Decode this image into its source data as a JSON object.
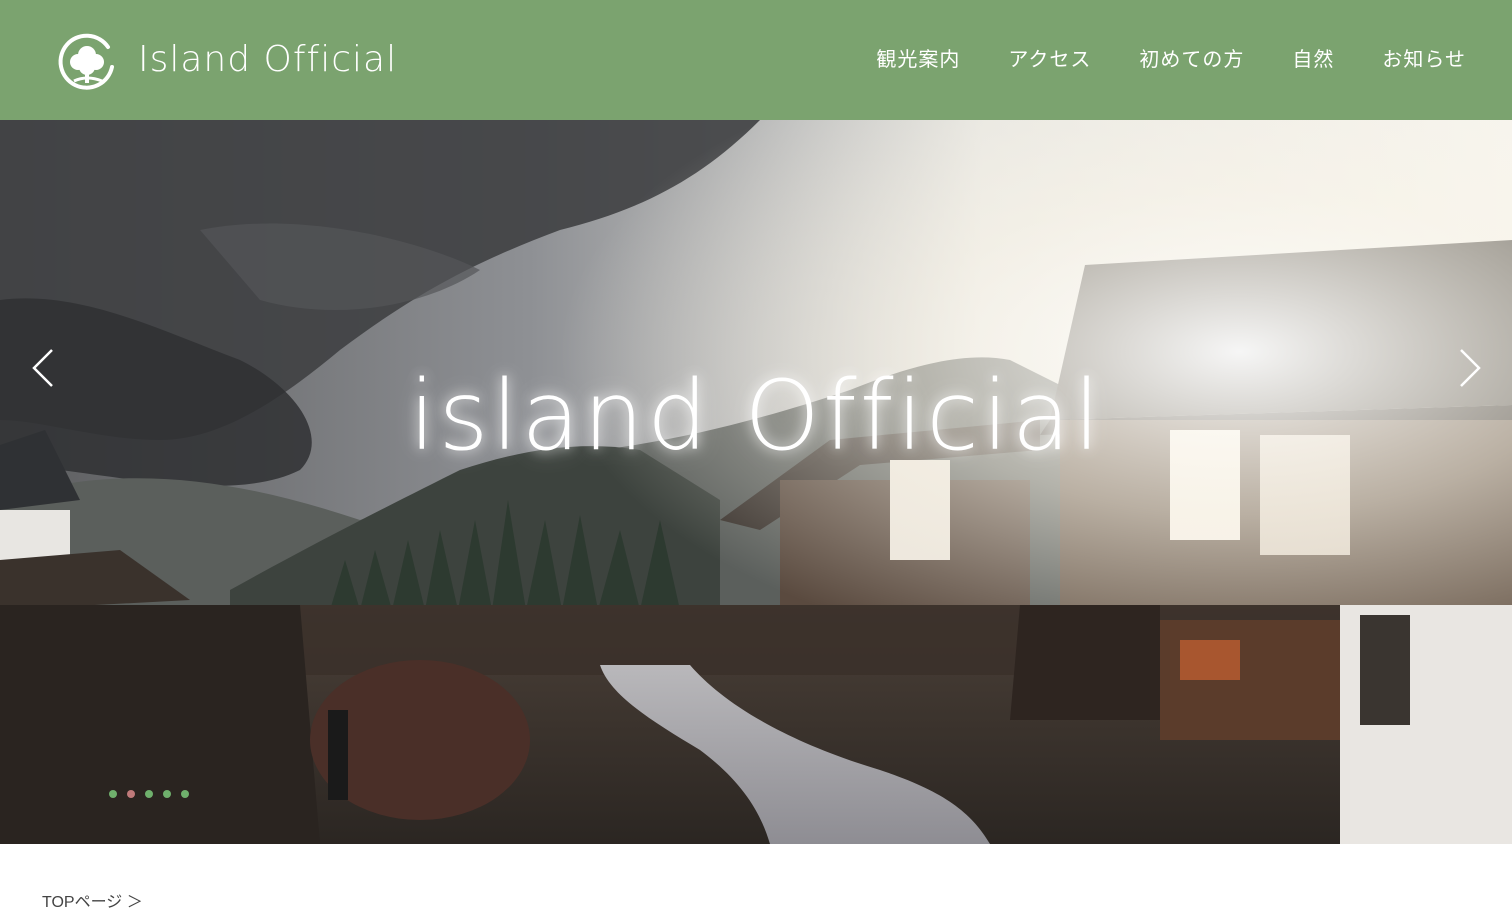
{
  "header": {
    "logo_text": "Island Official",
    "logo_icon": "tree-leaf-logo-icon",
    "bg_color": "#7ba36f"
  },
  "nav": {
    "items": [
      {
        "label": "観光案内"
      },
      {
        "label": "アクセス"
      },
      {
        "label": "初めての方"
      },
      {
        "label": "自然"
      },
      {
        "label": "お知らせ"
      }
    ]
  },
  "hero": {
    "title": "island Official",
    "prev_icon": "chevron-left-icon",
    "next_icon": "chevron-right-icon",
    "slides_total": 5,
    "active_slide": 2,
    "dot_color": "#6fb06c",
    "active_dot_color": "#c07a7a"
  },
  "breadcrumb": {
    "label": "TOPページ ＞"
  }
}
